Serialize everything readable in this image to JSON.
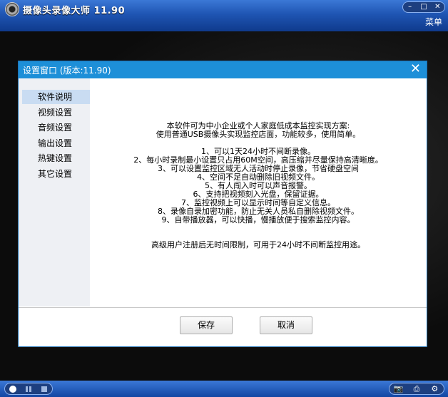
{
  "app": {
    "title": "摄像头录像大师  11.90",
    "menu_label": "菜单",
    "window_buttons": [
      "–",
      "□",
      "✕"
    ]
  },
  "dialog": {
    "title": "设置窗口 (版本:11.90)",
    "close": "✕",
    "sidebar": {
      "items": [
        {
          "label": "软件说明",
          "active": true
        },
        {
          "label": "视频设置",
          "active": false
        },
        {
          "label": "音频设置",
          "active": false
        },
        {
          "label": "输出设置",
          "active": false
        },
        {
          "label": "热键设置",
          "active": false
        },
        {
          "label": "其它设置",
          "active": false
        }
      ]
    },
    "content": {
      "lines": [
        "本软件可为中小企业或个人家庭低成本监控实现方案:",
        "使用普通USB摄像头实现监控店面，功能较多，使用简单。",
        "",
        "1、可以1天24小时不间断录像。",
        "2、每小时录制最小设置只占用60M空间，高压缩并尽量保持高清晰度。",
        "3、可以设置监控区域无人活动时停止录像，节省硬盘空间",
        "4、空间不足自动删除旧视频文件。",
        "5、有人闯入时可以声音报警。",
        "6、支持把视频刻入光盘，保留证据。",
        "7、监控视频上可以显示时间等自定义信息。",
        "8、录像自录加密功能，防止无关人员私自删除视频文件。",
        "9、自带播放器，可以快播，慢播放便于搜索监控内容。",
        "",
        "高级用户注册后无时间限制，可用于24小时不间断监控用途。"
      ]
    },
    "buttons": {
      "save": "保存",
      "cancel": "取消"
    }
  },
  "bottom_bar": {
    "tool_icons": [
      "📷",
      "⎙",
      "⚙"
    ]
  }
}
